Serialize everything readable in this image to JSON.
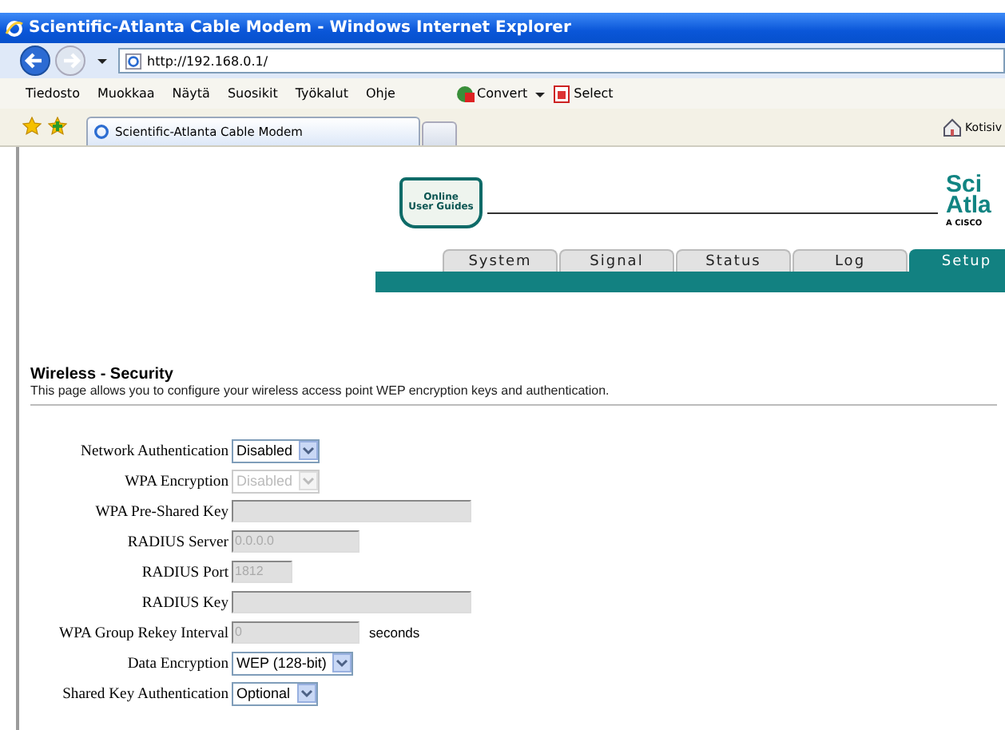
{
  "window": {
    "title": "Scientific-Atlanta Cable Modem - Windows Internet Explorer"
  },
  "address_bar": {
    "url": "http://192.168.0.1/"
  },
  "menu": [
    "Tiedosto",
    "Muokkaa",
    "Näytä",
    "Suosikit",
    "Työkalut",
    "Ohje"
  ],
  "toolbar": {
    "convert": "Convert",
    "select": "Select"
  },
  "browser_tab": {
    "title": "Scientific-Atlanta Cable Modem"
  },
  "home_button": "Kotisiv",
  "guide_book": {
    "line1": "Online",
    "line2": "User Guides"
  },
  "logo": {
    "line1": "Sci",
    "line2": "Atla",
    "tagline": "A CISCO"
  },
  "nav_tabs": [
    {
      "label": "System",
      "selected": false
    },
    {
      "label": "Signal",
      "selected": false
    },
    {
      "label": "Status",
      "selected": false
    },
    {
      "label": "Log",
      "selected": false
    },
    {
      "label": "Setup",
      "selected": true
    }
  ],
  "heading": "Wireless - Security",
  "description": "This page allows you to configure your wireless access point WEP encryption keys and authentication.",
  "fields": [
    {
      "label": "Network Authentication",
      "kind": "select",
      "value": "Disabled",
      "disabled": false
    },
    {
      "label": "WPA Encryption",
      "kind": "select",
      "value": "Disabled",
      "disabled": true
    },
    {
      "label": "WPA Pre-Shared Key",
      "kind": "wide",
      "disabled": true
    },
    {
      "label": "RADIUS Server",
      "kind": "text",
      "value": "0.0.0.0",
      "disabled": true
    },
    {
      "label": "RADIUS Port",
      "kind": "short",
      "value": "1812",
      "disabled": true
    },
    {
      "label": "RADIUS Key",
      "kind": "wide",
      "disabled": true
    },
    {
      "label": "WPA Group Rekey Interval",
      "kind": "text",
      "value": "0",
      "disabled": true,
      "suffix": "seconds"
    },
    {
      "label": "Data Encryption",
      "kind": "select",
      "value": "WEP (128-bit)",
      "disabled": false
    },
    {
      "label": "Shared Key Authentication",
      "kind": "select",
      "value": "Optional",
      "disabled": false
    }
  ]
}
